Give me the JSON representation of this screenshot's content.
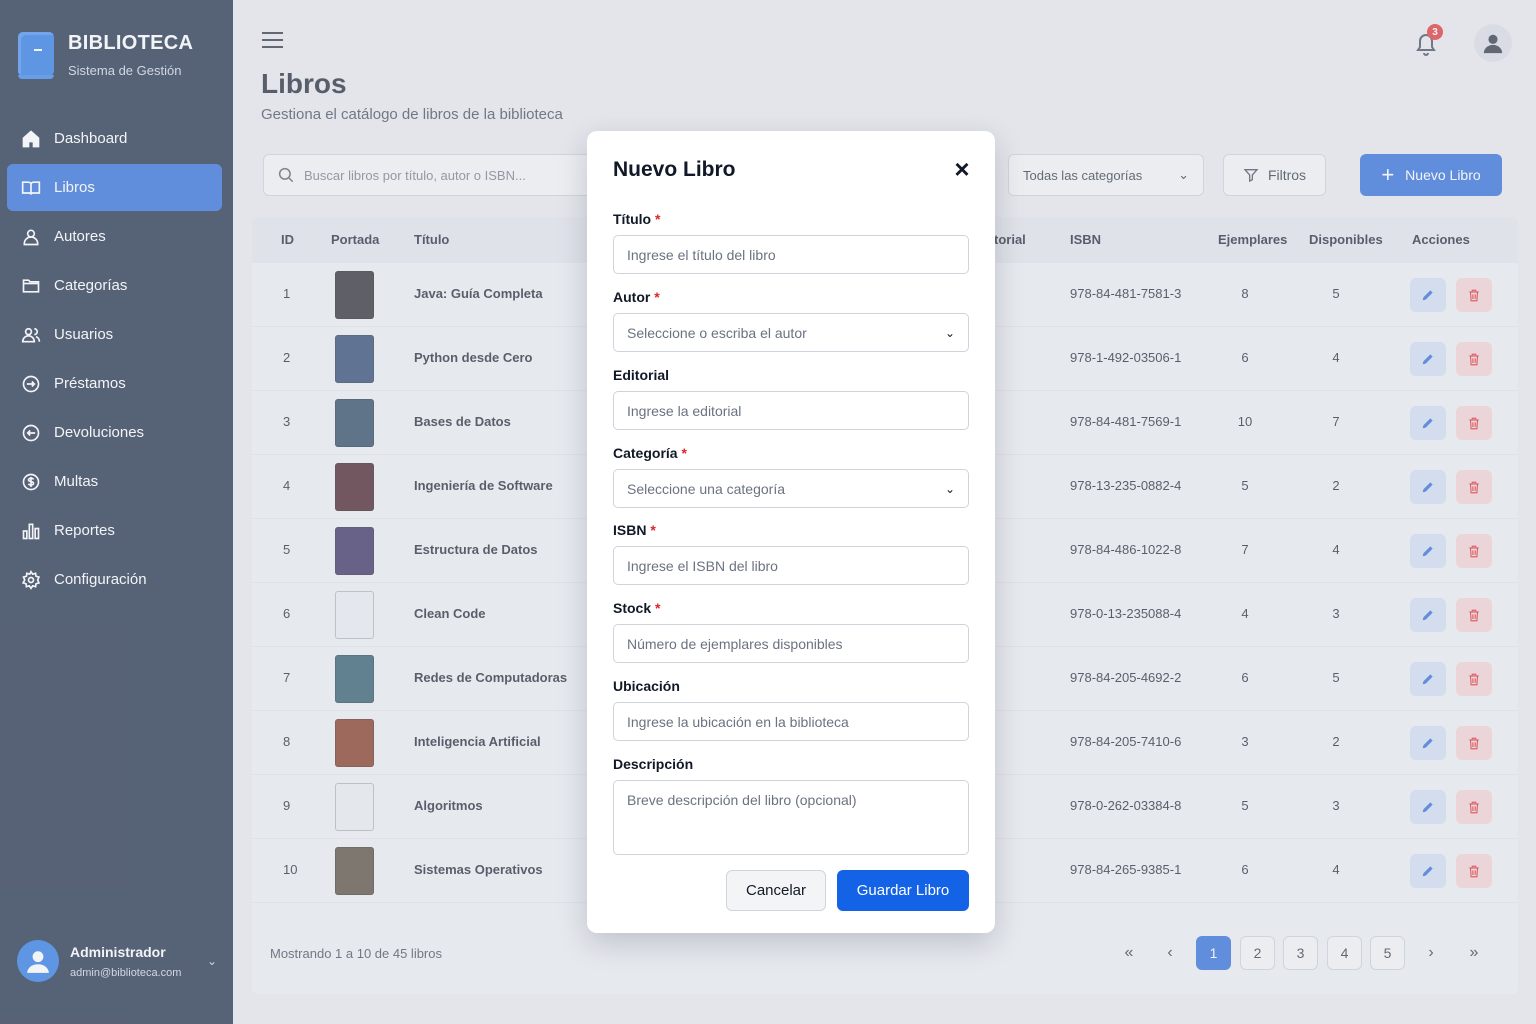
{
  "brand": {
    "title": "BIBLIOTECA",
    "subtitle": "Sistema de Gestión"
  },
  "sidebar": {
    "items": [
      {
        "label": "Dashboard",
        "icon": "home-icon"
      },
      {
        "label": "Libros",
        "icon": "book-open-icon",
        "active": true
      },
      {
        "label": "Autores",
        "icon": "user-icon"
      },
      {
        "label": "Categorías",
        "icon": "folder-icon"
      },
      {
        "label": "Usuarios",
        "icon": "users-icon"
      },
      {
        "label": "Préstamos",
        "icon": "arrow-right-circle-icon"
      },
      {
        "label": "Devoluciones",
        "icon": "arrow-left-circle-icon"
      },
      {
        "label": "Multas",
        "icon": "dollar-circle-icon"
      },
      {
        "label": "Reportes",
        "icon": "bar-chart-icon"
      },
      {
        "label": "Configuración",
        "icon": "gear-icon"
      }
    ],
    "user": {
      "name": "Administrador",
      "email": "admin@biblioteca.com"
    }
  },
  "header": {
    "notifications": "3",
    "title": "Libros",
    "subtitle": "Gestiona el catálogo de libros de la biblioteca"
  },
  "toolbar": {
    "search_placeholder": "Buscar libros por título, autor o ISBN...",
    "category_select": "Todas las categorías",
    "filters_label": "Filtros",
    "new_label": "Nuevo Libro"
  },
  "table": {
    "columns": {
      "id": "ID",
      "cover": "Portada",
      "title": "Título",
      "editorial": "torial",
      "isbn": "ISBN",
      "copies": "Ejemplares",
      "available": "Disponibles",
      "actions": "Acciones"
    },
    "rows": [
      {
        "id": "1",
        "title": "Java: Guía Completa",
        "isbn": "978-84-481-7581-3",
        "copies": "8",
        "available": "5",
        "cover_color": "#1c1c22"
      },
      {
        "id": "2",
        "title": "Python desde Cero",
        "isbn": "978-1-492-03506-1",
        "copies": "6",
        "available": "4",
        "cover_color": "#1f3a66"
      },
      {
        "id": "3",
        "title": "Bases de Datos",
        "isbn": "978-84-481-7569-1",
        "copies": "10",
        "available": "7",
        "cover_color": "#1e3b57"
      },
      {
        "id": "4",
        "title": "Ingeniería de Software",
        "isbn": "978-13-235-0882-4",
        "copies": "5",
        "available": "2",
        "cover_color": "#3a0f17"
      },
      {
        "id": "5",
        "title": "Estructura de Datos",
        "isbn": "978-84-486-1022-8",
        "copies": "7",
        "available": "4",
        "cover_color": "#2b1f55"
      },
      {
        "id": "6",
        "title": "Clean Code",
        "isbn": "978-0-13-235088-4",
        "copies": "4",
        "available": "3",
        "cover_color": "#e8ecf0"
      },
      {
        "id": "7",
        "title": "Redes de Computadoras",
        "isbn": "978-84-205-4692-2",
        "copies": "6",
        "available": "5",
        "cover_color": "#1f4f63"
      },
      {
        "id": "8",
        "title": "Inteligencia Artificial",
        "isbn": "978-84-205-7410-6",
        "copies": "3",
        "available": "2",
        "cover_color": "#7a2a12"
      },
      {
        "id": "9",
        "title": "Algoritmos",
        "isbn": "978-0-262-03384-8",
        "copies": "5",
        "available": "3",
        "cover_color": "#e9ebee"
      },
      {
        "id": "10",
        "title": "Sistemas Operativos",
        "isbn": "978-84-265-9385-1",
        "copies": "6",
        "available": "4",
        "cover_color": "#4a4030"
      }
    ],
    "footer": "Mostrando 1 a 10 de 45 libros",
    "pages": [
      "1",
      "2",
      "3",
      "4",
      "5"
    ],
    "current_page": "1"
  },
  "modal": {
    "title": "Nuevo Libro",
    "fields": {
      "titulo": {
        "label": "Título",
        "placeholder": "Ingrese el título del libro"
      },
      "autor": {
        "label": "Autor",
        "placeholder": "Seleccione o escriba el autor"
      },
      "editorial": {
        "label": "Editorial",
        "placeholder": "Ingrese la editorial"
      },
      "categoria": {
        "label": "Categoría",
        "placeholder": "Seleccione una categoría"
      },
      "isbn": {
        "label": "ISBN",
        "placeholder": "Ingrese el ISBN del libro"
      },
      "stock": {
        "label": "Stock",
        "placeholder": "Número de ejemplares disponibles"
      },
      "ubicacion": {
        "label": "Ubicación",
        "placeholder": "Ingrese la ubicación en la biblioteca"
      },
      "descripcion": {
        "label": "Descripción",
        "placeholder": "Breve descripción del libro (opcional)"
      }
    },
    "cancel_label": "Cancelar",
    "save_label": "Guardar Libro"
  },
  "colors": {
    "sidebar_bg": "#0f1f3a",
    "accent": "#1f63d6",
    "danger": "#dc2626"
  }
}
